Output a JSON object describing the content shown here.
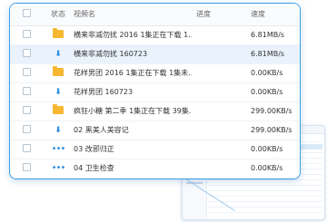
{
  "header": {
    "status": "状态",
    "name": "视频名",
    "progress": "进度",
    "speed": "速度"
  },
  "rows": [
    {
      "icon": "folder-icon",
      "name": "横来非减勿扰 2016   1集正在下载 1...",
      "progress": 0,
      "speed": "6.81MB/s",
      "selected": false
    },
    {
      "icon": "download-arrow-icon",
      "name": "横来非减勿扰 160723",
      "progress": 0.08,
      "speed": "6.81MB/s",
      "selected": true
    },
    {
      "icon": "folder-icon",
      "name": "花样男团 2016   1集正在下载 1集未...",
      "progress": 0,
      "speed": "0.00KB/s",
      "selected": false
    },
    {
      "icon": "download-arrow-icon",
      "name": "花样男团 160723",
      "progress": 0,
      "speed": "0.00KB/s",
      "selected": false
    },
    {
      "icon": "folder-icon",
      "name": "疯狂小糖 第二季   1集正在下载 39集...",
      "progress": 0,
      "speed": "299.00KB/s",
      "selected": false
    },
    {
      "icon": "download-arrow-icon",
      "name": "02 黑美人美容记",
      "progress": 0.85,
      "speed": "299.00KB/s",
      "selected": false
    },
    {
      "icon": "waiting-dots-icon",
      "name": "03 改邪归正",
      "progress": 0.7,
      "speed": "0.00KB/s",
      "selected": false
    },
    {
      "icon": "waiting-dots-icon",
      "name": "04 卫生检查",
      "progress": 0,
      "speed": "0.00KB/s",
      "selected": false
    }
  ],
  "colors": {
    "accent": "#2d8fe0",
    "folder": "#f7b731",
    "border": "#3fa0e8"
  }
}
